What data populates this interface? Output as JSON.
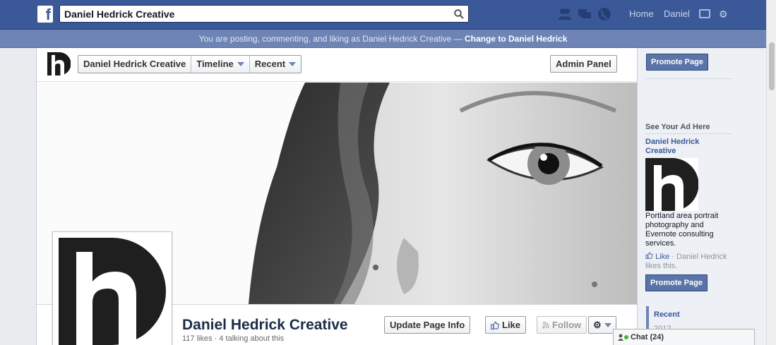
{
  "topbar": {
    "search_value": "Daniel Hedrick Creative",
    "home_label": "Home",
    "user_label": "Daniel"
  },
  "voice": {
    "text": "You are posting, commenting, and liking as Daniel Hedrick Creative —",
    "switch_label": "Change to Daniel Hedrick"
  },
  "pagebar": {
    "crumbs": [
      "Daniel Hedrick Creative",
      "Timeline",
      "Recent"
    ],
    "admin_label": "Admin Panel"
  },
  "page": {
    "name": "Daniel Hedrick Creative",
    "stats": "117 likes · 4 talking about this",
    "update_label": "Update Page Info",
    "like_label": "Like",
    "follow_label": "Follow"
  },
  "rightcol": {
    "promote_label": "Promote Page",
    "ad_heading": "See Your Ad Here",
    "ad_title": "Daniel Hedrick Creative",
    "ad_desc": "Portland area portrait photography and Evernote consulting services.",
    "ad_like_link": "Like",
    "ad_like_text": " · Daniel Hedrick likes this.",
    "promote_label_2": "Promote Page",
    "recent_label": "Recent",
    "recent_next": "2012"
  },
  "chat": {
    "label": "Chat (24)"
  },
  "colors": {
    "topbar": "#3b5998",
    "voicebar": "#6d84b4",
    "link": "#3b5998",
    "promote": "#5b74a8",
    "online": "#42b72a"
  }
}
